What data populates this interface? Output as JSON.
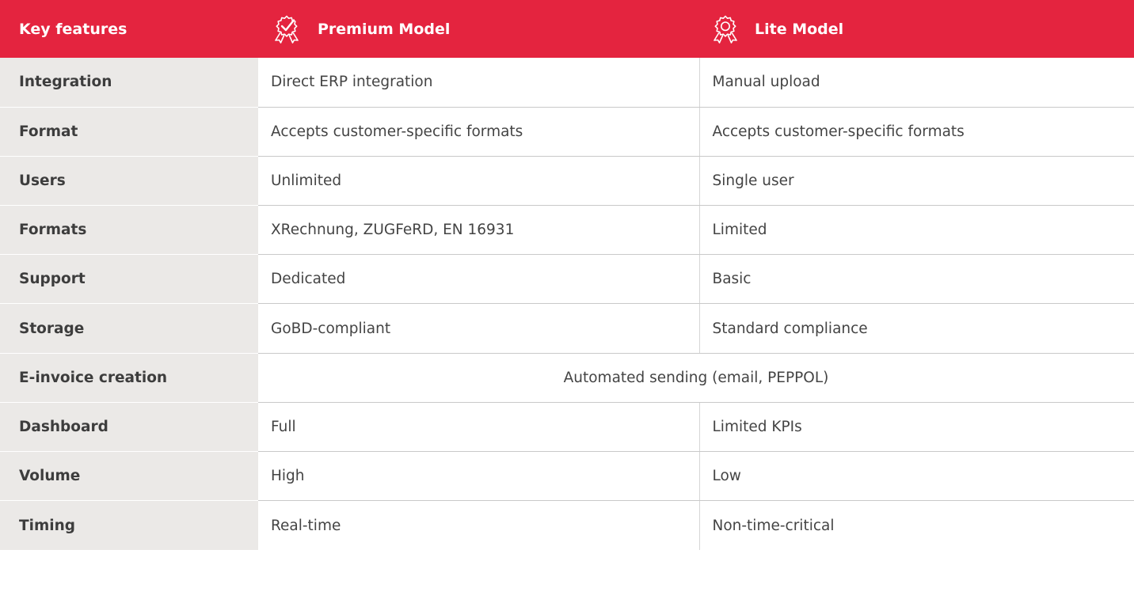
{
  "header": {
    "key_features": "Key features",
    "premium": {
      "label": "Premium Model",
      "icon": "award-check-icon"
    },
    "lite": {
      "label": "Lite Model",
      "icon": "award-ribbon-icon"
    }
  },
  "colors": {
    "header_bg": "#e4243f",
    "feature_bg": "#ebe9e7",
    "header_text": "#ffffff",
    "body_text": "#444444"
  },
  "rows": [
    {
      "feature": "Integration",
      "premium": "Direct ERP integration",
      "lite": "Manual upload"
    },
    {
      "feature": "Format",
      "premium": "Accepts customer-specific formats",
      "lite": "Accepts customer-specific formats"
    },
    {
      "feature": "Users",
      "premium": "Unlimited",
      "lite": "Single user"
    },
    {
      "feature": "Formats",
      "premium": "XRechnung, ZUGFeRD, EN 16931",
      "lite": "Limited"
    },
    {
      "feature": "Support",
      "premium": "Dedicated",
      "lite": "Basic"
    },
    {
      "feature": "Storage",
      "premium": "GoBD-compliant",
      "lite": "Standard compliance"
    },
    {
      "feature": "E-invoice creation",
      "shared": "Automated sending (email, PEPPOL)"
    },
    {
      "feature": "Dashboard",
      "premium": "Full",
      "lite": "Limited KPIs"
    },
    {
      "feature": "Volume",
      "premium": "High",
      "lite": "Low"
    },
    {
      "feature": "Timing",
      "premium": "Real-time",
      "lite": "Non-time-critical"
    }
  ]
}
